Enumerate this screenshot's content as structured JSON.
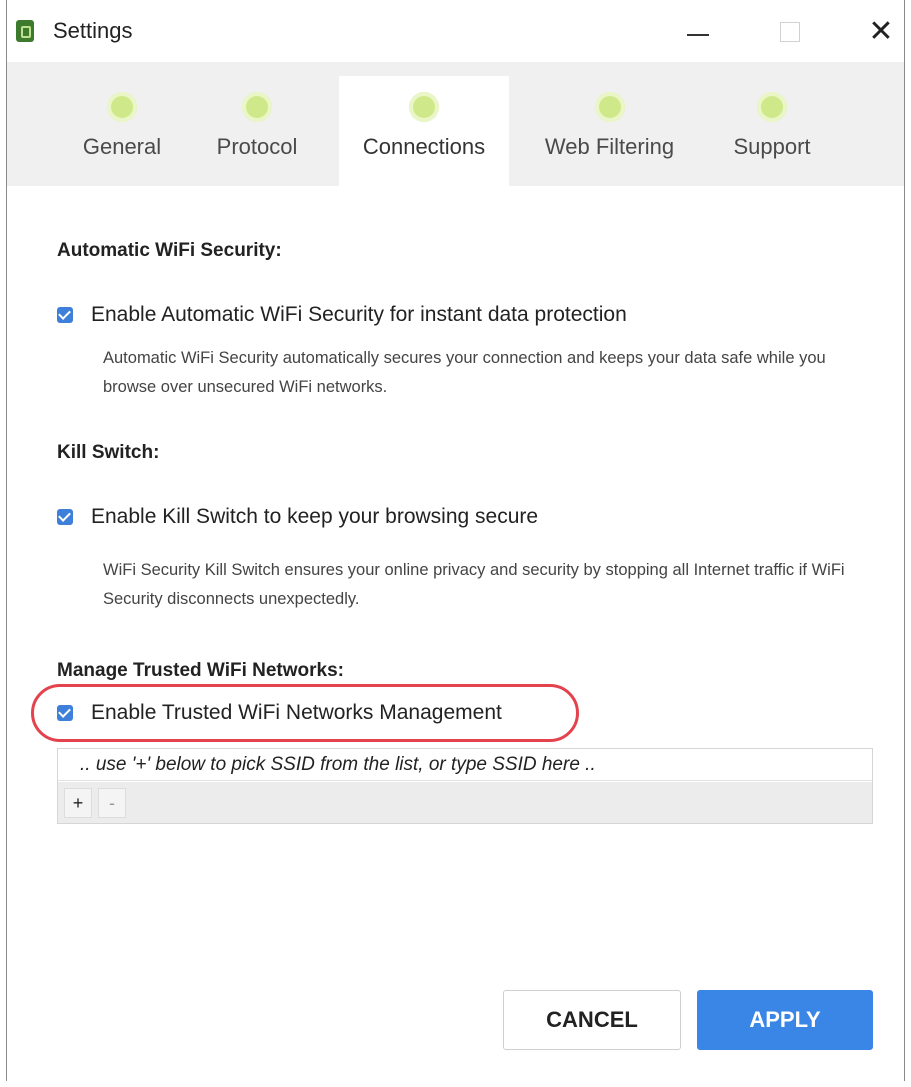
{
  "window": {
    "title": "Settings"
  },
  "tabs": [
    {
      "label": "General",
      "icon": "gear-icon",
      "active": false
    },
    {
      "label": "Protocol",
      "icon": "key-icon",
      "active": false
    },
    {
      "label": "Connections",
      "icon": "connection-icon",
      "active": true
    },
    {
      "label": "Web Filtering",
      "icon": "filter-icon",
      "active": false
    },
    {
      "label": "Support",
      "icon": "support-icon",
      "active": false
    }
  ],
  "sections": {
    "wifi_security": {
      "title": "Automatic WiFi Security:",
      "checkbox_label": "Enable Automatic WiFi Security for instant data protection",
      "checked": true,
      "description": "Automatic WiFi Security automatically secures your connection and keeps your data safe while you browse over unsecured WiFi networks."
    },
    "kill_switch": {
      "title": "Kill Switch:",
      "checkbox_label": "Enable Kill Switch to keep your browsing secure",
      "checked": true,
      "description": "WiFi Security Kill Switch ensures your online privacy and security by stopping all Internet traffic if WiFi Security disconnects unexpectedly."
    },
    "trusted_networks": {
      "title": "Manage Trusted WiFi Networks:",
      "checkbox_label": "Enable Trusted WiFi Networks Management",
      "checked": true,
      "ssid_placeholder": ".. use '+' below to pick SSID from the list, or type SSID here ..",
      "add_label": "+",
      "remove_label": "-"
    }
  },
  "footer": {
    "cancel_label": "CANCEL",
    "apply_label": "APPLY"
  },
  "colors": {
    "accent": "#3a86e6",
    "highlight": "#e4434d",
    "icon_green": "#cfe98a"
  }
}
